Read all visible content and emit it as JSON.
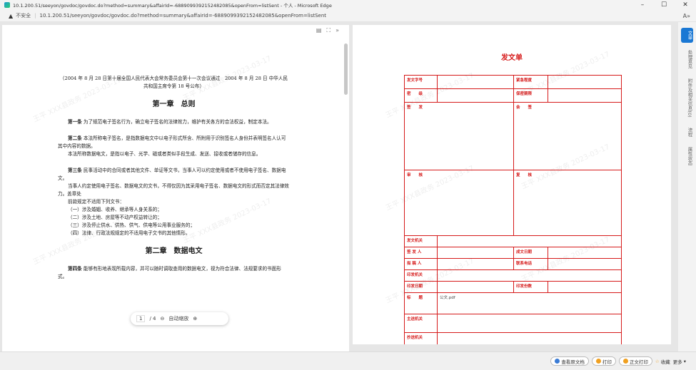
{
  "titlebar": {
    "title": "10.1.200.51/seeyon/govdoc/govdoc.do?method=summary&affairId=-6889099392152482085&openFrom=listSent - 个人 - Microsoft Edge",
    "minimize": "–",
    "maximize": "☐",
    "close": "✕"
  },
  "addressbar": {
    "warning": "▲",
    "insecure": "不安全",
    "url": "10.1.200.51/seeyon/govdoc/govdoc.do?method=summary&affairId=-6889099392152482085&openFrom=listSent",
    "read_aloud": "A»"
  },
  "left": {
    "toolbar": [
      "▤",
      "⛶",
      "»"
    ],
    "preface": "（2004 年 8 月 28 日第十届全国人民代表大会常务委员会第十一次会议通过　2004 年 8 月 28 日 中华人民共和国主席令第 18 号公布）",
    "chapter1": "第一章　总则",
    "a1_label": "第一条",
    "a1": "为了规范电子签名行为，确立电子签名的法律效力，维护有关各方的合法权益，制定本法。",
    "a2_label": "第二条",
    "a2": "本法所称电子签名，是指数据电文中以电子形式所含、所附用于识别签名人身份并表明签名人认可其中内容的数据。",
    "a2b": "本法所称数据电文，是指以电子、光学、磁或者类似手段生成、发送、接收或者储存的信息。",
    "a3_label": "第三条",
    "a3": "民事活动中的合同或者其他文件、单证等文书，当事人可以约定使用或者不使用电子签名、数据电文。",
    "a3b": "当事人约定使用电子签名、数据电文的文书，不得仅因为其采用电子签名、数据电文的形式而否定其法律效力。盖章处",
    "a3c": "前款规定不适用下列文书：",
    "a3d1": "（一）涉及婚姻、收养、继承等人身关系的；",
    "a3d2": "（二）涉及土地、房屋等不动产权益转让的；",
    "a3d3": "（三）涉及停止供水、供热、供气、供电等公用事业服务的；",
    "a3d4": "（四）法律、行政法规规定的不适用电子文书的其他情形。",
    "chapter2": "第二章　数据电文",
    "a4_label": "第四条",
    "a4": "能够有形地表现所载内容，并可以随时调取查用的数据电文，视为符合法律、法规要求的书面形式。",
    "pager": {
      "current": "1",
      "total": "/ 4",
      "zoom_out": "⊖",
      "zoom": "自动缩放",
      "zoom_in": "⊕"
    }
  },
  "right": {
    "form_title": "发文单",
    "fields": {
      "doc_no": "发文字号",
      "urgency": "紧急程度",
      "secret": "密　　级",
      "secret_period": "保密期限",
      "sign": "签　　发",
      "countersign": "会　　签",
      "review": "审　　核",
      "recheck": "复　　核",
      "issuer_org": "发文机关",
      "signer": "签 发 人",
      "date_issued": "成文日期",
      "drafter": "拟 稿 人",
      "phone": "联系电话",
      "print_org": "印发机关",
      "print_date": "印发日期",
      "print_copies": "印发份数",
      "title": "标　　题",
      "title_value": "公文.pdf",
      "main_send": "主送机关",
      "copy_send": "抄送机关"
    }
  },
  "watermark": "王平 XXX县政务 2023-03-17",
  "rightbar": [
    "文单",
    "处理意见",
    "附件及相关信息(0)",
    "流程",
    "属性状态"
  ],
  "bottombar": {
    "view_original": "查看原文档",
    "print": "打印",
    "print_body": "正文打印",
    "favorite": "收藏",
    "more": "更多"
  }
}
